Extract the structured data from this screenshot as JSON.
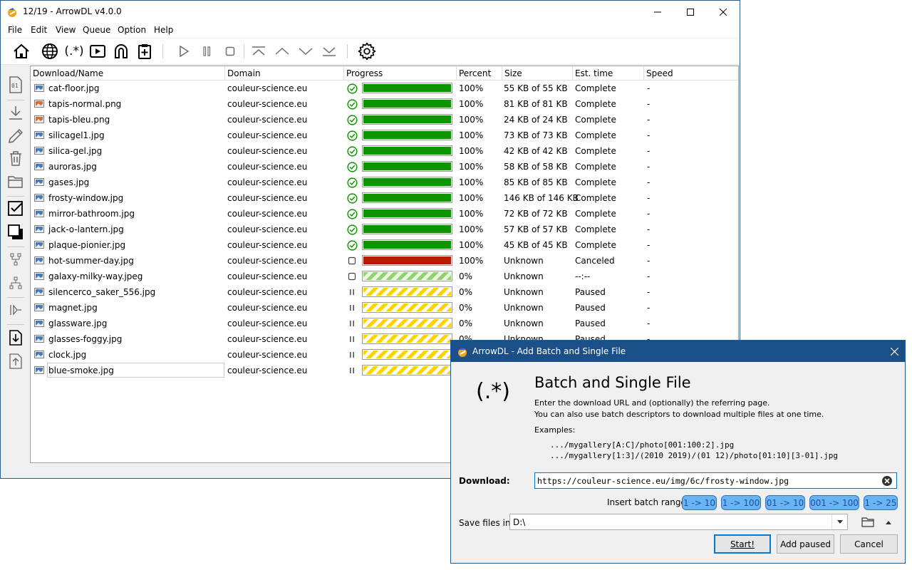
{
  "window": {
    "title": "12/19 - ArrowDL v4.0.0"
  },
  "menu": [
    "File",
    "Edit",
    "View",
    "Queue",
    "Option",
    "Help"
  ],
  "toolbar": {
    "icons": [
      "home-icon",
      "globe-icon",
      "regex-icon",
      "video-icon",
      "magnet-icon",
      "clipboard-add-icon",
      "play-icon",
      "pause-icon",
      "stop-icon",
      "move-top-icon",
      "move-up-icon",
      "move-down-icon",
      "move-bottom-icon",
      "settings-gear-icon"
    ],
    "regex_glyph": "(.*)"
  },
  "sidebar": {
    "icons": [
      "info-01-icon",
      "download-icon",
      "edit-pencil-icon",
      "trash-icon",
      "folder-icon",
      "checkbox-icon",
      "select-all-icon",
      "tree-icon",
      "hierarchy-icon",
      "queue-icon",
      "import-icon",
      "export-icon"
    ],
    "info_glyph": "01"
  },
  "table": {
    "columns": [
      "Download/Name",
      "Domain",
      "Progress",
      "Percent",
      "Size",
      "Est. time",
      "Speed"
    ],
    "rows": [
      {
        "name": "cat-floor.jpg",
        "domain": "couleur-science.eu",
        "state": "complete",
        "percent": "100%",
        "size": "55 KB of 55 KB",
        "est": "Complete",
        "speed": "-",
        "progress": 1.0
      },
      {
        "name": "tapis-normal.png",
        "domain": "couleur-science.eu",
        "state": "complete",
        "percent": "100%",
        "size": "81 KB of 81 KB",
        "est": "Complete",
        "speed": "-",
        "progress": 1.0
      },
      {
        "name": "tapis-bleu.png",
        "domain": "couleur-science.eu",
        "state": "complete",
        "percent": "100%",
        "size": "24 KB of 24 KB",
        "est": "Complete",
        "speed": "-",
        "progress": 1.0
      },
      {
        "name": "silicagel1.jpg",
        "domain": "couleur-science.eu",
        "state": "complete",
        "percent": "100%",
        "size": "73 KB of 73 KB",
        "est": "Complete",
        "speed": "-",
        "progress": 1.0
      },
      {
        "name": "silica-gel.jpg",
        "domain": "couleur-science.eu",
        "state": "complete",
        "percent": "100%",
        "size": "42 KB of 42 KB",
        "est": "Complete",
        "speed": "-",
        "progress": 1.0
      },
      {
        "name": "auroras.jpg",
        "domain": "couleur-science.eu",
        "state": "complete",
        "percent": "100%",
        "size": "58 KB of 58 KB",
        "est": "Complete",
        "speed": "-",
        "progress": 1.0
      },
      {
        "name": "gases.jpg",
        "domain": "couleur-science.eu",
        "state": "complete",
        "percent": "100%",
        "size": "85 KB of 85 KB",
        "est": "Complete",
        "speed": "-",
        "progress": 1.0
      },
      {
        "name": "frosty-window.jpg",
        "domain": "couleur-science.eu",
        "state": "complete",
        "percent": "100%",
        "size": "146 KB of 146 KB",
        "est": "Complete",
        "speed": "-",
        "progress": 1.0
      },
      {
        "name": "mirror-bathroom.jpg",
        "domain": "couleur-science.eu",
        "state": "complete",
        "percent": "100%",
        "size": "72 KB of 72 KB",
        "est": "Complete",
        "speed": "-",
        "progress": 1.0
      },
      {
        "name": "jack-o-lantern.jpg",
        "domain": "couleur-science.eu",
        "state": "complete",
        "percent": "100%",
        "size": "57 KB of 57 KB",
        "est": "Complete",
        "speed": "-",
        "progress": 1.0
      },
      {
        "name": "plaque-pionier.jpg",
        "domain": "couleur-science.eu",
        "state": "complete",
        "percent": "100%",
        "size": "45 KB of 45 KB",
        "est": "Complete",
        "speed": "-",
        "progress": 1.0
      },
      {
        "name": "hot-summer-day.jpg",
        "domain": "couleur-science.eu",
        "state": "canceled",
        "percent": "100%",
        "size": "Unknown",
        "est": "Canceled",
        "speed": "-",
        "progress": 1.0
      },
      {
        "name": "galaxy-milky-way.jpeg",
        "domain": "couleur-science.eu",
        "state": "idle",
        "percent": "0%",
        "size": "Unknown",
        "est": "--:--",
        "speed": "-",
        "progress": 0.0
      },
      {
        "name": "silencerco_saker_556.jpg",
        "domain": "couleur-science.eu",
        "state": "paused",
        "percent": "0%",
        "size": "Unknown",
        "est": "Paused",
        "speed": "-",
        "progress": 0.0
      },
      {
        "name": "magnet.jpg",
        "domain": "couleur-science.eu",
        "state": "paused",
        "percent": "0%",
        "size": "Unknown",
        "est": "Paused",
        "speed": "-",
        "progress": 0.0
      },
      {
        "name": "glassware.jpg",
        "domain": "couleur-science.eu",
        "state": "paused",
        "percent": "0%",
        "size": "Unknown",
        "est": "Paused",
        "speed": "-",
        "progress": 0.0
      },
      {
        "name": "glasses-foggy.jpg",
        "domain": "couleur-science.eu",
        "state": "paused",
        "percent": "0%",
        "size": "Unknown",
        "est": "Paused",
        "speed": "-",
        "progress": 0.0
      },
      {
        "name": "clock.jpg",
        "domain": "couleur-science.eu",
        "state": "paused",
        "percent": "",
        "size": "",
        "est": "",
        "speed": "",
        "progress": 0.0
      },
      {
        "name": "blue-smoke.jpg",
        "domain": "couleur-science.eu",
        "state": "paused",
        "percent": "",
        "size": "",
        "est": "",
        "speed": "",
        "progress": 0.0
      }
    ]
  },
  "colors": {
    "complete": "#0d9400",
    "canceled": "#b51b00",
    "paused_stripe": "#ffd200",
    "idle_stripe": "#8fd36a",
    "dialog_title": "#1a4f87",
    "chip": "#6ab4f3"
  },
  "dialog": {
    "title": "ArrowDL - Add Batch and Single File",
    "logo": "(.*)",
    "heading": "Batch and Single File",
    "desc1": "Enter the download URL and (optionally) the referring page.",
    "desc2": "You can also use batch descriptors to download multiple files at one time.",
    "examples_label": "Examples:",
    "example1": ".../mygallery[A:C]/photo[001:100:2].jpg",
    "example2": ".../mygallery[1:3]/(2010 2019)/(01 12)/photo[01:10][3-01].jpg",
    "download_label": "Download:",
    "download_value": "https://couleur-science.eu/img/6c/frosty-window.jpg",
    "insert_label": "Insert batch range:",
    "ranges": [
      "1 -> 10",
      "1 -> 100",
      "01 -> 10",
      "001 -> 100",
      "1 -> 25"
    ],
    "save_label": "Save files in:",
    "save_value": "D:\\",
    "start": "Start!",
    "add_paused": "Add paused",
    "cancel": "Cancel"
  }
}
